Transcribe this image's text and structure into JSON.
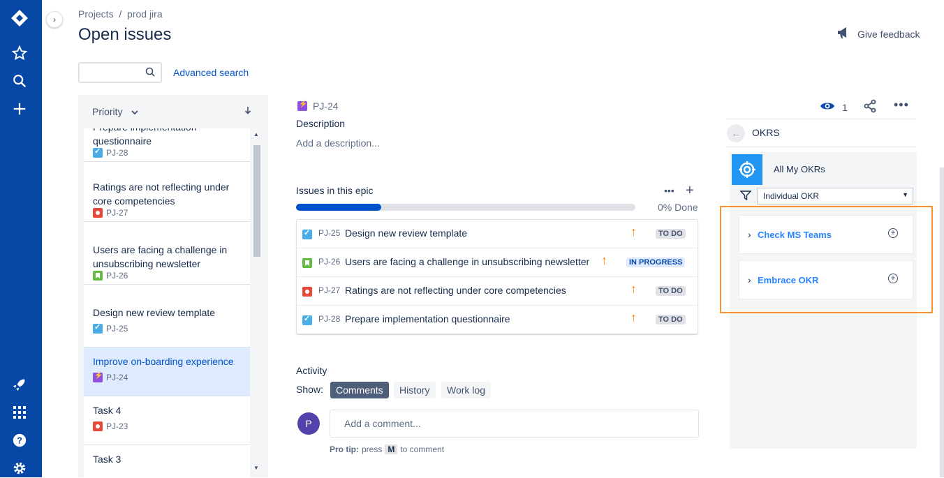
{
  "breadcrumb": {
    "root": "Projects",
    "sep": "/",
    "project": "prod jira"
  },
  "page_title": "Open issues",
  "feedback_label": "Give feedback",
  "search": {
    "placeholder": "",
    "advanced_label": "Advanced search"
  },
  "list": {
    "sort_label": "Priority",
    "cards": [
      {
        "title": "Prepare implementation questionnaire",
        "key": "PJ-28",
        "type": "task"
      },
      {
        "title": "Ratings are not reflecting under core competencies",
        "key": "PJ-27",
        "type": "bug"
      },
      {
        "title": "Users are facing a challenge in unsubscribing newsletter",
        "key": "PJ-26",
        "type": "story"
      },
      {
        "title": "Design new review template",
        "key": "PJ-25",
        "type": "task"
      },
      {
        "title": "Improve on-boarding experience",
        "key": "PJ-24",
        "type": "epic",
        "selected": true
      },
      {
        "title": "Task 4",
        "key": "PJ-23",
        "type": "bug"
      },
      {
        "title": "Task 3",
        "key": "",
        "type": ""
      }
    ]
  },
  "issue": {
    "key": "PJ-24",
    "watchers": "1",
    "description_heading": "Description",
    "description_placeholder": "Add a description...",
    "epic_heading": "Issues in this epic",
    "progress_percent": 0.25,
    "progress_label": "0% Done",
    "children": [
      {
        "key": "PJ-25",
        "summary": "Design new review template",
        "status": "TO DO",
        "type": "task"
      },
      {
        "key": "PJ-26",
        "summary": "Users are facing a challenge in unsubscribing newsletter",
        "status": "IN PROGRESS",
        "type": "story"
      },
      {
        "key": "PJ-27",
        "summary": "Ratings are not reflecting under core competencies",
        "status": "TO DO",
        "type": "bug"
      },
      {
        "key": "PJ-28",
        "summary": "Prepare implementation questionnaire",
        "status": "TO DO",
        "type": "task"
      }
    ]
  },
  "activity": {
    "heading": "Activity",
    "show_label": "Show:",
    "tabs": [
      "Comments",
      "History",
      "Work log"
    ],
    "avatar_initial": "P",
    "comment_placeholder": "Add a comment...",
    "protip_bold": "Pro tip:",
    "protip_press": "press",
    "protip_key": "M",
    "protip_rest": "to comment"
  },
  "okr": {
    "title": "OKRS",
    "all_label": "All My OKRs",
    "filter_value": "Individual OKR",
    "items": [
      "Check MS Teams",
      "Embrace OKR"
    ]
  },
  "colors": {
    "nav": "#0747a6",
    "accent": "#0052cc",
    "highlight": "#f79232"
  }
}
